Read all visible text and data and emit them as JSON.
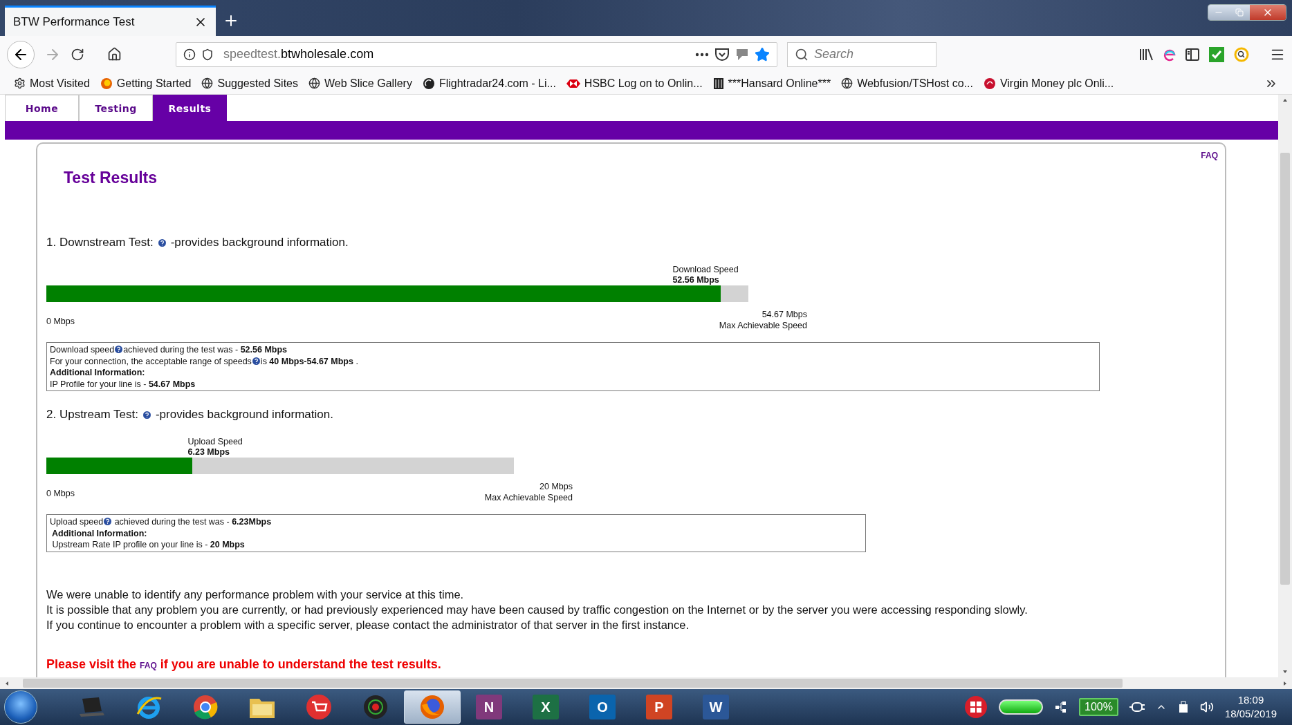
{
  "browser": {
    "tab_title": "BTW Performance Test",
    "url_prefix": "speedtest.",
    "url_domain": "btwholesale.com",
    "search_placeholder": "Search",
    "bookmarks": [
      {
        "kind": "gear",
        "label": "Most Visited"
      },
      {
        "kind": "fox",
        "label": "Getting Started"
      },
      {
        "kind": "globe",
        "label": "Suggested Sites"
      },
      {
        "kind": "globe",
        "label": "Web Slice Gallery"
      },
      {
        "kind": "radar",
        "label": "Flightradar24.com - Li..."
      },
      {
        "kind": "hexagon",
        "label": "HSBC Log on to Onlin..."
      },
      {
        "kind": "building",
        "label": "***Hansard Online***"
      },
      {
        "kind": "globe",
        "label": "Webfusion/TSHost co..."
      },
      {
        "kind": "swirl",
        "label": "Virgin Money plc Onli..."
      }
    ]
  },
  "site_tabs": [
    {
      "label": "Home",
      "selected": false
    },
    {
      "label": "Testing",
      "selected": false
    },
    {
      "label": "Results",
      "selected": true
    }
  ],
  "faq": "FAQ",
  "title": "Test Results",
  "tests": [
    {
      "heading": "1. Downstream Test:",
      "info": "-provides background information.",
      "speed_label": "Download Speed",
      "speed_value": "52.56 Mbps",
      "level": 0.961,
      "min_label": "0 Mbps",
      "max_value": "54.67 Mbps",
      "max_label": "Max Achievable Speed",
      "lines": [
        {
          "parts": [
            "Download speed",
            "achieved during the test was - **52.56 Mbps**"
          ],
          "bold": false
        },
        {
          "parts": [
            "For your connection, the acceptable range of speeds",
            "is **40 Mbps-54.67 Mbps** ."
          ],
          "bold": false
        },
        {
          "parts": [
            "Additional Information:"
          ],
          "bold": true
        },
        {
          "parts": [
            "IP Profile for your line is - **54.67 Mbps**"
          ],
          "bold": false
        }
      ]
    },
    {
      "heading": "2. Upstream Test:",
      "info": "-provides background information.",
      "speed_label": "Upload Speed",
      "speed_value": "6.23 Mbps",
      "level": 0.3115,
      "min_label": "0 Mbps",
      "max_value": "20 Mbps",
      "max_label": "Max Achievable Speed",
      "lines": [
        {
          "parts": [
            "Upload speed",
            " achieved during the test was - **6.23Mbps**"
          ],
          "bold": false
        },
        {
          "parts": [
            " Additional Information:"
          ],
          "bold": true
        },
        {
          "parts": [
            " Upstream Rate IP profile on your line is - **20 Mbps**"
          ],
          "bold": false
        }
      ]
    }
  ],
  "messages": [
    "We were unable to identify any performance problem with your service at this time.",
    "It is possible that any problem you are currently, or had previously experienced may have been caused by traffic congestion on the Internet or by the server you were accessing responding slowly.",
    "If you continue to encounter a problem with a specific server, please contact the administrator of that server in the first instance."
  ],
  "notice": {
    "before": "Please visit the",
    "link": "FAQ",
    "after": "if you are unable to understand the test results."
  },
  "taskbar": {
    "apps": [
      {
        "kind": "laptop",
        "selected": false
      },
      {
        "kind": "ie",
        "selected": false
      },
      {
        "kind": "chrome",
        "selected": false
      },
      {
        "kind": "folder",
        "selected": false
      },
      {
        "kind": "cart",
        "selected": false
      },
      {
        "kind": "lens",
        "selected": false
      },
      {
        "kind": "fox",
        "selected": true
      },
      {
        "kind": "office",
        "letter": "N",
        "color": "#80397b",
        "selected": false
      },
      {
        "kind": "office",
        "letter": "X",
        "color": "#1d7044",
        "selected": false
      },
      {
        "kind": "office",
        "letter": "O",
        "color": "#0a64ad",
        "selected": false
      },
      {
        "kind": "office",
        "letter": "P",
        "color": "#d04423",
        "selected": false
      },
      {
        "kind": "office",
        "letter": "W",
        "color": "#2b5797",
        "selected": false
      }
    ],
    "battery": "100%",
    "time": "18:09",
    "date": "18/05/2019"
  }
}
